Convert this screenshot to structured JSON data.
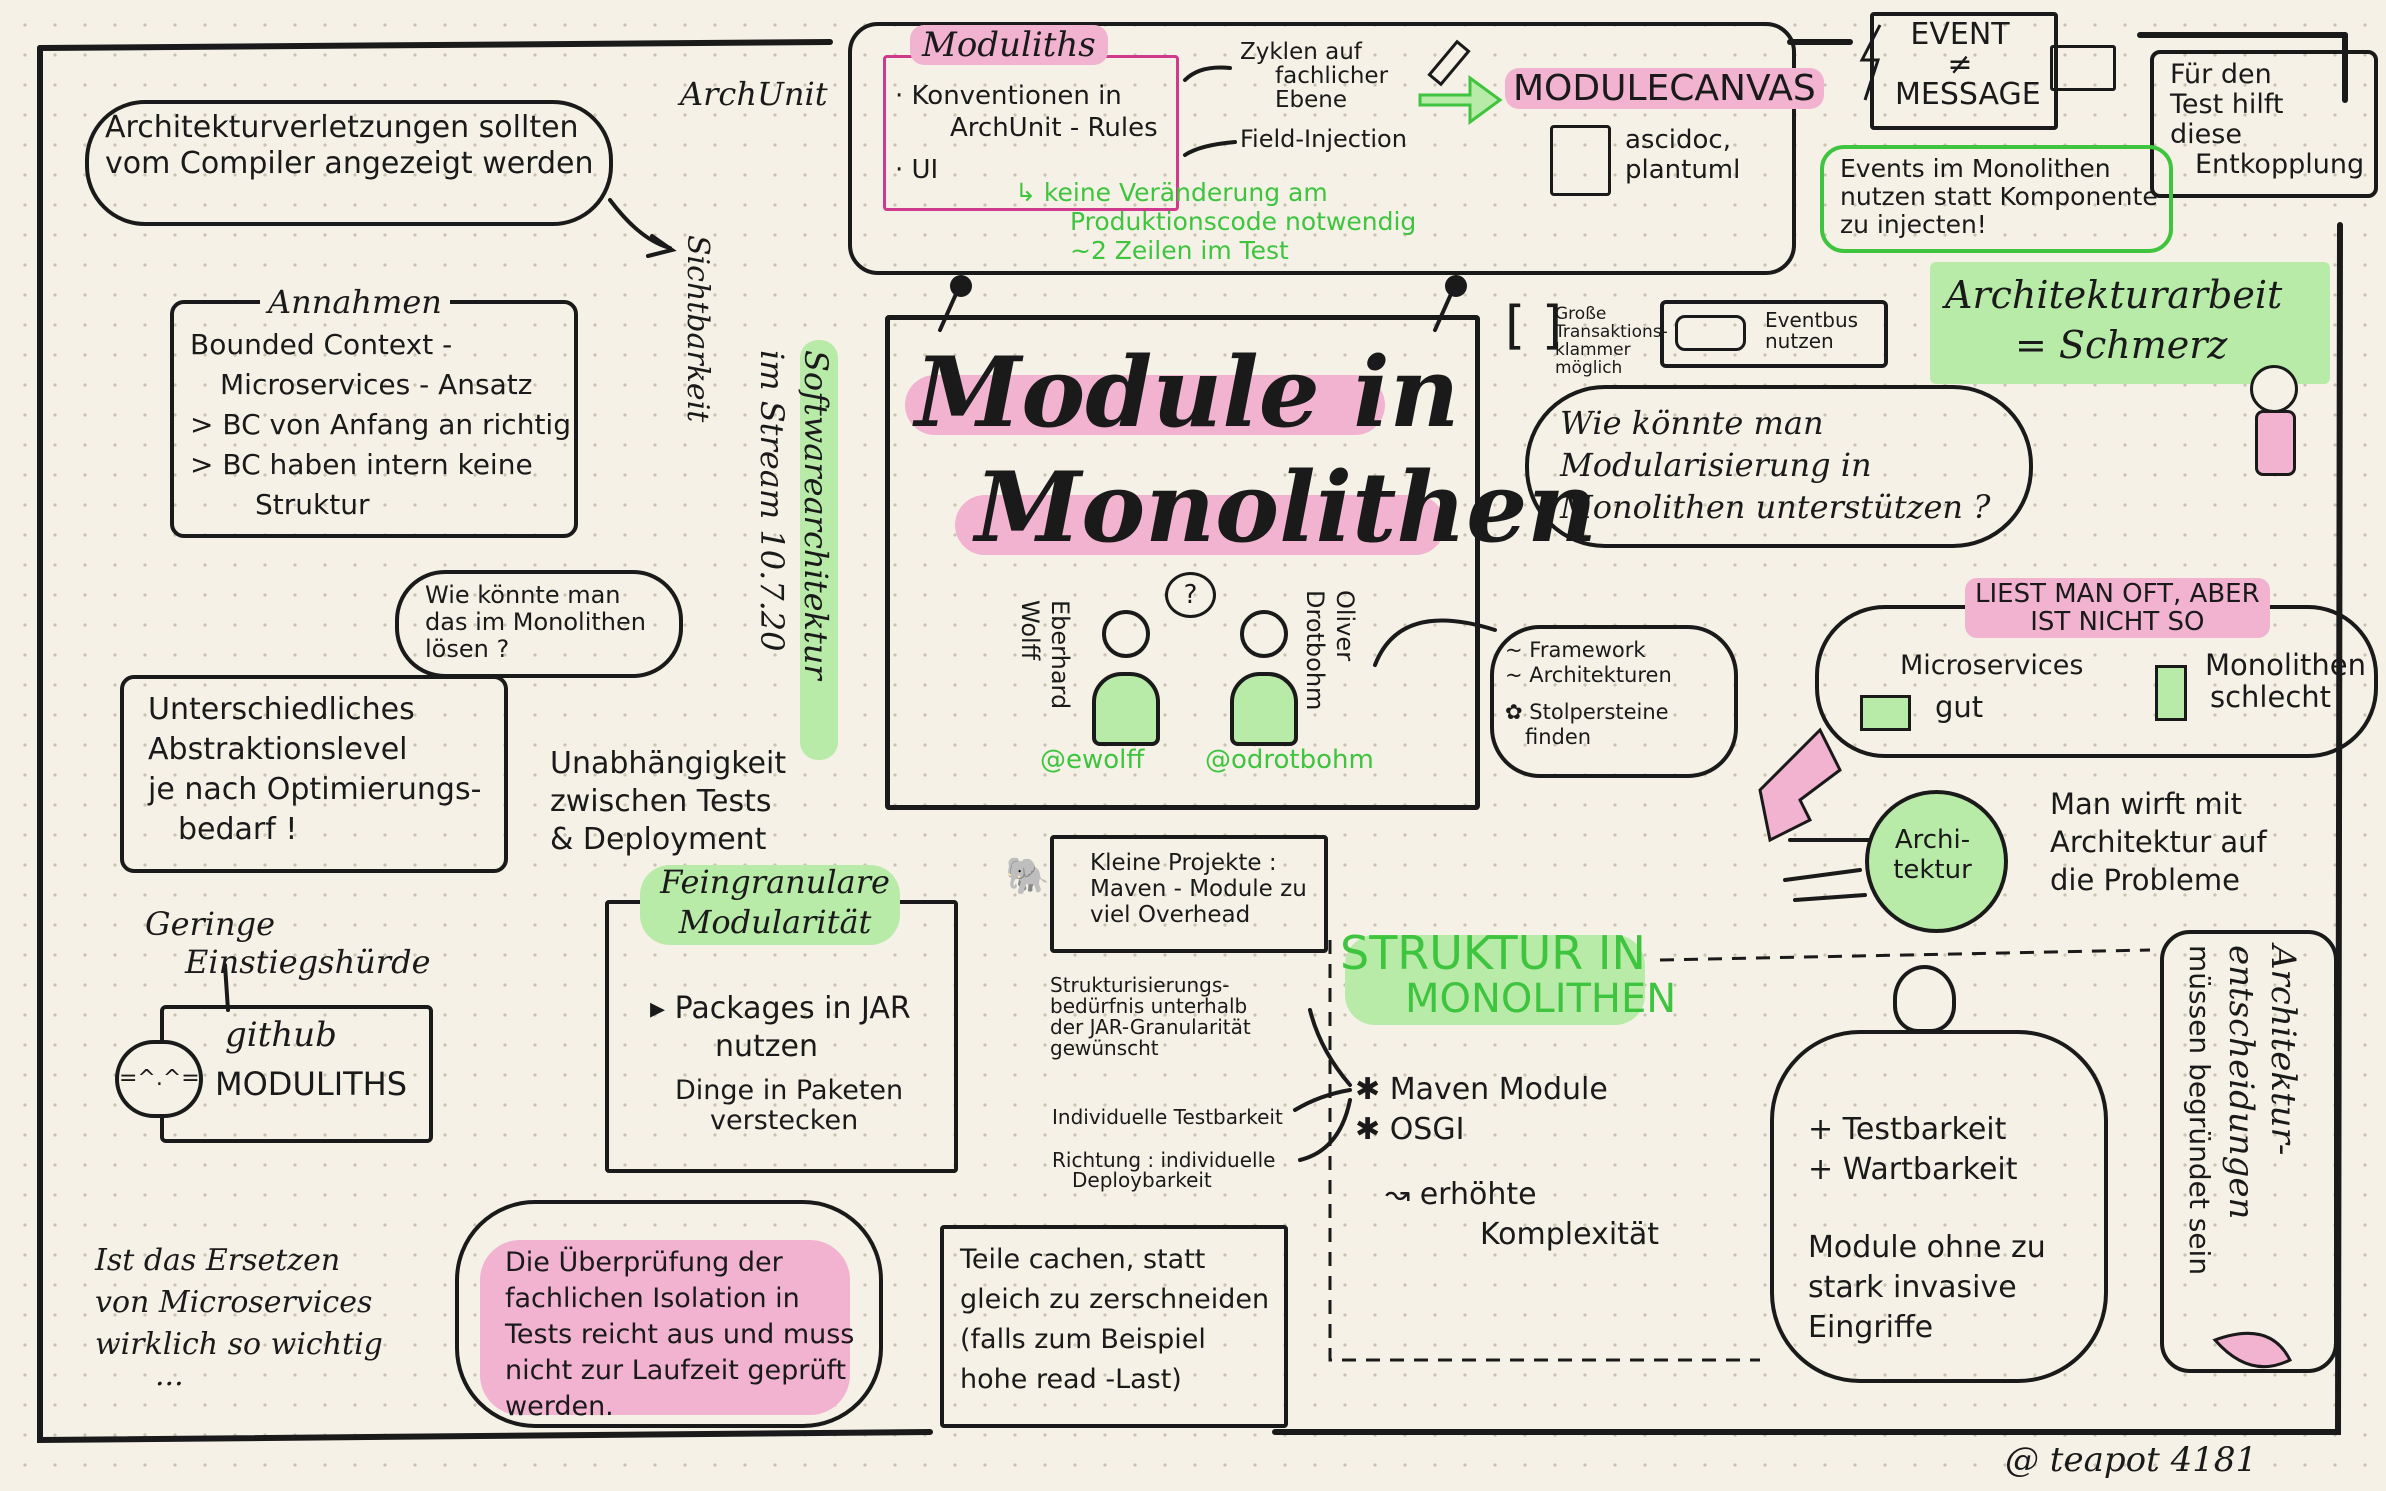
{
  "title": {
    "line1": "Module in",
    "line2": "Monolithen"
  },
  "speakers": {
    "left_name_1": "Eberhard",
    "left_name_2": "Wolff",
    "left_handle": "@ewolff",
    "right_name_1": "Oliver",
    "right_name_2": "Drotbohm",
    "right_handle": "@odrotbohm",
    "question_mark": "?"
  },
  "stream_label": {
    "line1": "Softwarearchitektur",
    "line2": "im Stream 10.7.20"
  },
  "compiler_cloud": {
    "line1": "Architekturverletzungen sollten",
    "line2": "vom Compiler angezeigt werden"
  },
  "archunit": "ArchUnit",
  "sichtbarkeit": "Sichtbarkeit",
  "annahmen": {
    "heading": "Annahmen",
    "lines": [
      "Bounded Context -",
      "Microservices - Ansatz",
      "> BC von Anfang an richtig",
      "> BC haben intern keine",
      "Struktur"
    ]
  },
  "question_bubble": {
    "line1": "Wie könnte man",
    "line2": "das im Monolithen",
    "line3": "lösen ?"
  },
  "abstraktion": {
    "lines": [
      "Unterschiedliches",
      "Abstraktionslevel",
      "je nach Optimierungs-",
      "bedarf !"
    ]
  },
  "unabhaengigkeit": {
    "lines": [
      "Unabhängigkeit",
      "zwischen Tests",
      "& Deployment"
    ]
  },
  "einstieg": {
    "line1": "Geringe",
    "line2": "Einstiegshürde",
    "github": "github",
    "moduliths": "MODULITHS"
  },
  "feingranular": {
    "heading1": "Feingranulare",
    "heading2": "Modularität",
    "item1a": "Packages in JAR",
    "item1b": "nutzen",
    "item2a": "Dinge in Paketen",
    "item2b": "verstecken"
  },
  "ersetzen": {
    "lines": [
      "Ist das Ersetzen",
      "von Microservices",
      "wirklich so wichtig",
      "..."
    ]
  },
  "isolation": {
    "lines": [
      "Die Überprüfung der",
      "fachlichen Isolation in",
      "Tests reicht aus und muss",
      "nicht zur Laufzeit geprüft",
      "werden."
    ]
  },
  "moduliths": {
    "heading": "Moduliths",
    "bullet1a": "Konventionen in",
    "bullet1b": "ArchUnit - Rules",
    "bullet2": "UI",
    "zyklen1": "Zyklen auf",
    "zyklen2": "fachlicher",
    "zyklen3": "Ebene",
    "field": "Field-Injection",
    "green1": "keine Veränderung am",
    "green2": "Produktionscode notwendig",
    "green3": "~2 Zeilen im Test",
    "modulecanvas": "MODULECANVAS",
    "asciidoc1": "ascidoc,",
    "asciidoc2": "plantuml"
  },
  "event": {
    "line1": "EVENT",
    "line2": "≠",
    "line3": "MESSAGE"
  },
  "test_hilft": {
    "lines": [
      "Für den",
      "Test hilft",
      "diese",
      "Entkopplung"
    ]
  },
  "events_mono": {
    "lines": [
      "Events im Monolithen",
      "nutzen statt Komponente",
      "zu injecten!"
    ]
  },
  "transaktion": {
    "lines": [
      "Große",
      "Transaktions-",
      "klammer",
      "möglich"
    ],
    "eventbus1": "Eventbus",
    "eventbus2": "nutzen"
  },
  "schmerz": {
    "line1": "Architekturarbeit",
    "line2": "= Schmerz"
  },
  "modularisierung": {
    "lines": [
      "Wie könnte man",
      "Modularisierung in",
      "Monolithen unterstützen ?"
    ]
  },
  "framework": {
    "line1": "~ Framework",
    "line2": "~ Architekturen",
    "line3": "Stolpersteine",
    "line4": "finden"
  },
  "liest": {
    "line1": "LIEST MAN OFT, ABER",
    "line2": "IST NICHT SO",
    "micro": "Microservices",
    "gut": "gut",
    "mono": "Monolithen",
    "schlecht": "schlecht"
  },
  "architektur_circle": {
    "line1": "Archi-",
    "line2": "tektur"
  },
  "wirft": {
    "lines": [
      "Man wirft mit",
      "Architektur auf",
      "die Probleme"
    ]
  },
  "kleine_projekte": {
    "lines": [
      "Kleine Projekte :",
      "Maven - Module zu",
      "viel Overhead"
    ]
  },
  "struktur": {
    "heading1": "STRUKTUR IN",
    "heading2": "MONOLITHEN",
    "maven": "Maven Module",
    "osgi": "OSGI",
    "erhoehte1": "erhöhte",
    "erhoehte2": "Komplexität",
    "left1": [
      "Strukturisierungs-",
      "bedürfnis unterhalb",
      "der JAR-Granularität",
      "gewünscht"
    ],
    "left2": "Individuelle Testbarkeit",
    "left3": [
      "Richtung : individuelle",
      "Deploybarkeit"
    ]
  },
  "vorteile": {
    "plus1": "+ Testbarkeit",
    "plus2": "+ Wartbarkeit",
    "lines": [
      "Module ohne zu",
      "stark invasive",
      "Eingriffe"
    ]
  },
  "entscheidungen": {
    "line1": "Architektur-",
    "line2": "entscheidungen",
    "line3": "müssen begründet sein"
  },
  "cachen": {
    "lines": [
      "Teile cachen, statt",
      "gleich zu zerschneiden",
      "(falls zum Beispiel",
      "hohe read -Last)"
    ]
  },
  "signature": "@ teapot 4181",
  "colors": {
    "pink": "#f2b3d0",
    "green": "#b8eaa8",
    "text_green": "#3ec43e",
    "ink": "#1a1a1a"
  }
}
